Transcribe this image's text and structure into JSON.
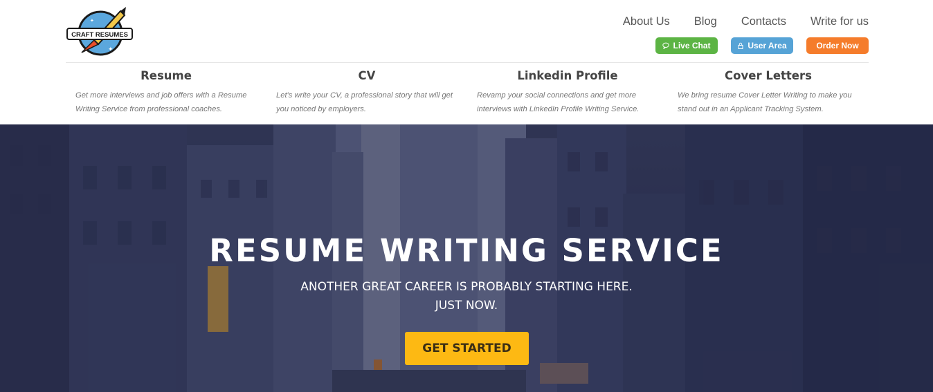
{
  "logo": {
    "text": "CRAFT RESUMES"
  },
  "nav": {
    "items": [
      {
        "label": "About Us"
      },
      {
        "label": "Blog"
      },
      {
        "label": "Contacts"
      },
      {
        "label": "Write for us"
      }
    ]
  },
  "actions": {
    "live_chat": "Live Chat",
    "user_area": "User Area",
    "order_now": "Order Now"
  },
  "services": [
    {
      "title": "Resume",
      "description": "Get more interviews and job offers with a Resume Writing Service from professional coaches."
    },
    {
      "title": "CV",
      "description": "Let's write your CV, a professional story that will get you noticed by employers."
    },
    {
      "title": "Linkedin Profile",
      "description": "Revamp your social connections and get more interviews with LinkedIn Profile Writing Service."
    },
    {
      "title": "Cover Letters",
      "description": "We bring resume Cover Letter Writing to make you stand out in an Applicant Tracking System."
    }
  ],
  "hero": {
    "title": "RESUME WRITING SERVICE",
    "subtitle_line1": "ANOTHER GREAT CAREER IS PROBABLY STARTING HERE.",
    "subtitle_line2": "JUST NOW.",
    "cta": "GET STARTED"
  },
  "colors": {
    "live_chat": "#5cb444",
    "user_area": "#56a3d6",
    "order_now": "#f57c2b",
    "cta": "#fdb913"
  },
  "icons": {
    "live_chat": "chat-bubble-icon",
    "user_area": "lock-icon"
  }
}
